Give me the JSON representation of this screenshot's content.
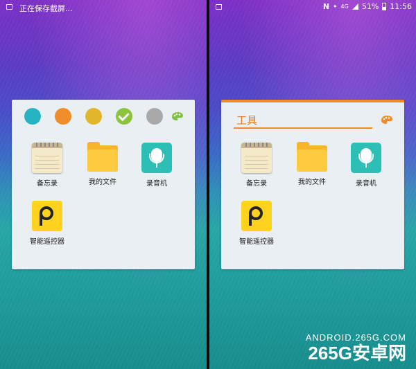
{
  "left": {
    "status_text": "正在保存截屏...",
    "swatches": [
      "#27b3c2",
      "#ef8d2a",
      "#e2b62b",
      "#8cc43b",
      "#a9a9a9"
    ],
    "selected_swatch_index": 3,
    "apps": [
      {
        "label": "备忘录",
        "icon": "notepad-icon"
      },
      {
        "label": "我的文件",
        "icon": "folder-icon"
      },
      {
        "label": "录音机",
        "icon": "voice-recorder-icon"
      },
      {
        "label": "智能遥控器",
        "icon": "smart-remote-icon"
      }
    ]
  },
  "right": {
    "status": {
      "carrier": "N",
      "network": "4G",
      "battery": "51%",
      "time": "11:56"
    },
    "folder_title": "工具",
    "accent_color": "#f28a26",
    "apps": [
      {
        "label": "备忘录",
        "icon": "notepad-icon"
      },
      {
        "label": "我的文件",
        "icon": "folder-icon"
      },
      {
        "label": "录音机",
        "icon": "voice-recorder-icon"
      },
      {
        "label": "智能遥控器",
        "icon": "smart-remote-icon"
      }
    ]
  },
  "watermark": {
    "url": "ANDROID.265G.COM",
    "brand": "265G安卓网"
  }
}
